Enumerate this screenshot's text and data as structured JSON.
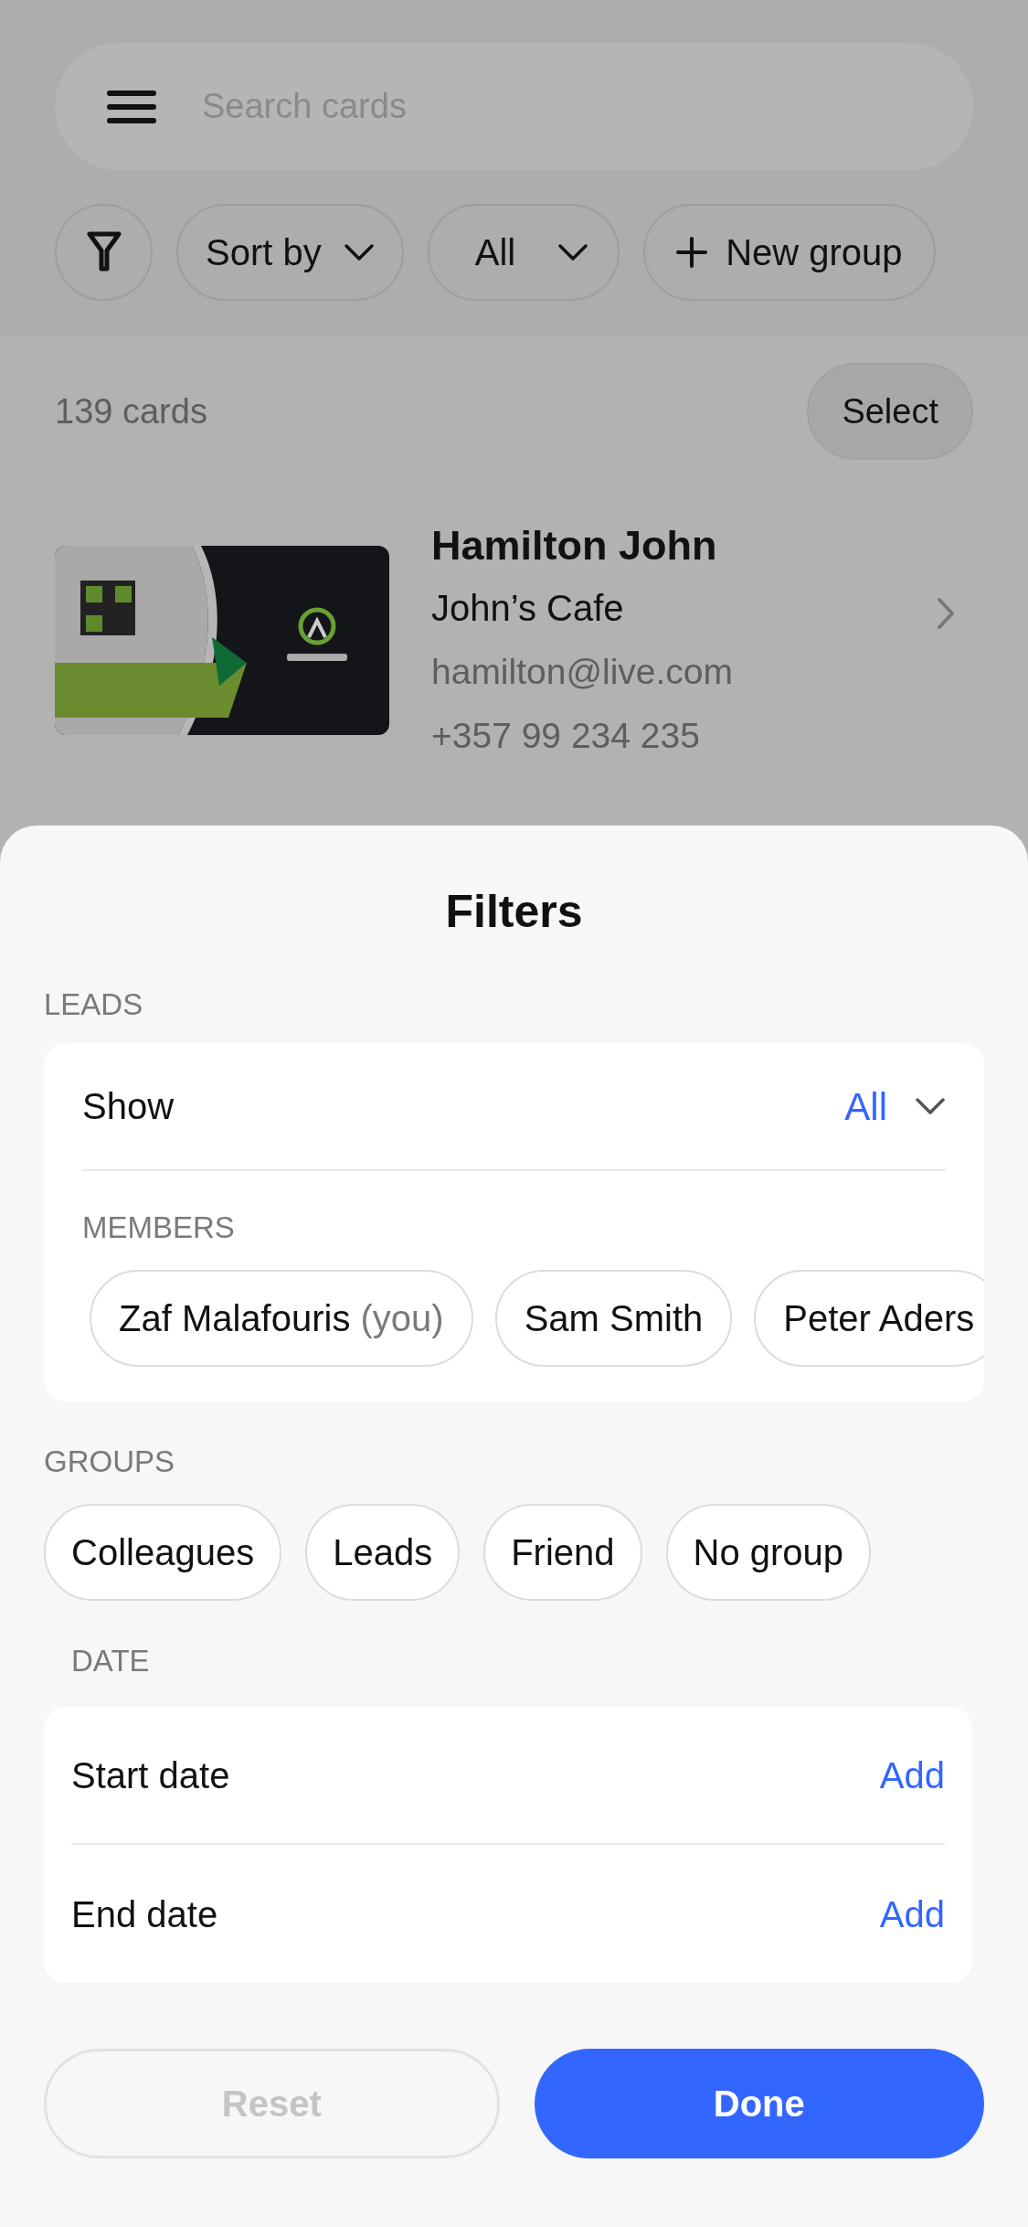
{
  "search": {
    "placeholder": "Search cards"
  },
  "toolbar": {
    "sort": "Sort by",
    "scope": "All",
    "new_group": "New group"
  },
  "list": {
    "count": "139 cards",
    "select": "Select",
    "cards": [
      {
        "kind": "picture",
        "name": "Hamilton John",
        "company": "John’s Cafe",
        "email": "hamilton@live.com",
        "phone": "+357 99 234 235"
      }
    ]
  },
  "filters": {
    "title": "Filters",
    "leads": {
      "label": "LEADS",
      "show_label": "Show",
      "show_value": "All",
      "members_label": "MEMBERS",
      "members": [
        {
          "name": "Zaf Malafouris",
          "note": "(you)"
        },
        {
          "name": "Sam Smith"
        },
        {
          "name": "Peter Aders"
        }
      ]
    },
    "groups": {
      "label": "GROUPS",
      "items": [
        "Colleagues",
        "Leads",
        "Friend",
        "No group"
      ]
    },
    "date": {
      "label": "DATE",
      "rows": [
        {
          "label": "Start date",
          "action": "Add"
        },
        {
          "label": "End date",
          "action": "Add"
        }
      ]
    },
    "buttons": [
      {
        "label": "Reset",
        "kind": "secondary",
        "disabled": true
      },
      {
        "label": "Done",
        "kind": "primary",
        "disabled": false
      }
    ]
  }
}
